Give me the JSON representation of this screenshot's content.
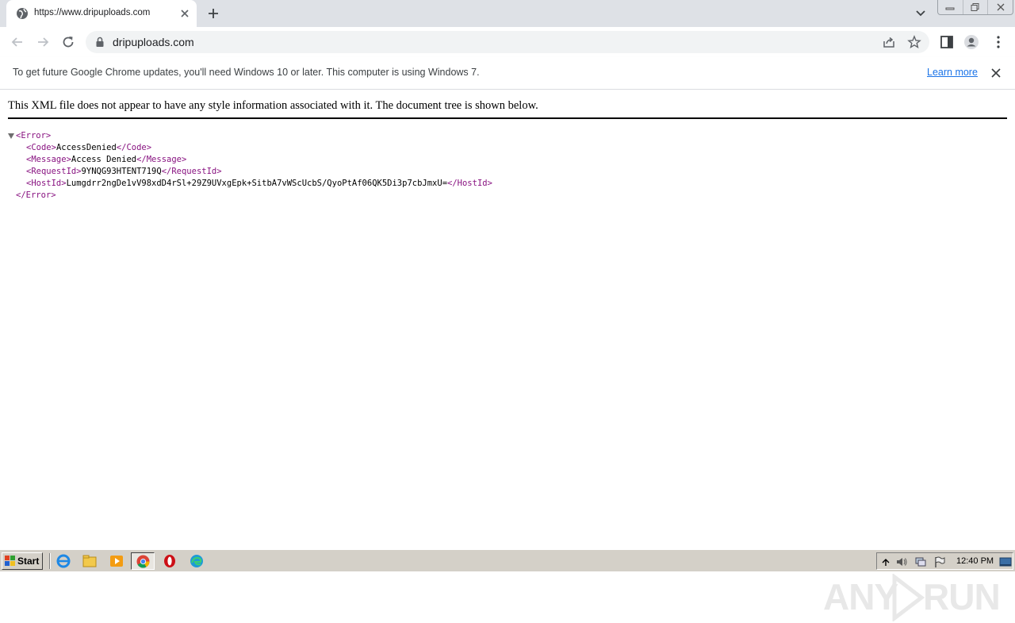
{
  "browser": {
    "tab": {
      "title": "https://www.dripuploads.com"
    },
    "address_bar": {
      "url": "dripuploads.com"
    }
  },
  "infobar": {
    "message": "To get future Google Chrome updates, you'll need Windows 10 or later. This computer is using Windows 7.",
    "link_label": "Learn more"
  },
  "page": {
    "xml_notice": "This XML file does not appear to have any style information associated with it. The document tree is shown below.",
    "xml": {
      "root_open": "<Error>",
      "root_close": "</Error>",
      "code": {
        "open": "<Code>",
        "value": "AccessDenied",
        "close": "</Code>"
      },
      "message": {
        "open": "<Message>",
        "value": "Access Denied",
        "close": "</Message>"
      },
      "request_id": {
        "open": "<RequestId>",
        "value": "9YNQG93HTENT719Q",
        "close": "</RequestId>"
      },
      "host_id": {
        "open": "<HostId>",
        "value": "Lumgdrr2ngDe1vV98xdD4rSl+29Z9UVxgEpk+SitbA7vWScUcbS/QyoPtAf06QK5Di3p7cbJmxU=",
        "close": "</HostId>"
      }
    }
  },
  "watermark": {
    "left": "ANY",
    "right": "RUN"
  },
  "taskbar": {
    "start_label": "Start",
    "clock": "12:40 PM"
  },
  "colors": {
    "tag": "#881280",
    "link": "#1a73e8",
    "tabstrip": "#dee1e6",
    "taskbar": "#d4d0c8"
  }
}
